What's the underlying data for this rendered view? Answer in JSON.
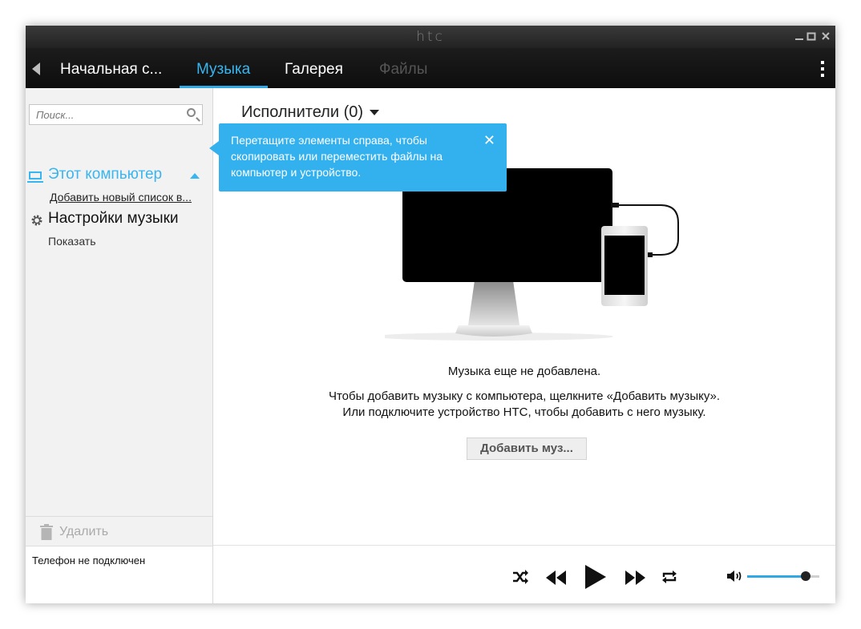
{
  "window": {
    "brand": "htc"
  },
  "nav": {
    "tabs": [
      {
        "label": "Начальная с...",
        "state": "normal"
      },
      {
        "label": "Музыка",
        "state": "active"
      },
      {
        "label": "Галерея",
        "state": "normal"
      },
      {
        "label": "Файлы",
        "state": "disabled"
      }
    ],
    "accent_color": "#2ea9e6"
  },
  "sidebar": {
    "search_placeholder": "Поиск...",
    "computer_label": "Этот компьютер",
    "add_playlist": "Добавить новый список в...",
    "settings_label": "Настройки музыки",
    "show_link": "Показать",
    "delete_label": "Удалить",
    "phone_status": "Телефон не подключен"
  },
  "main": {
    "heading": "Исполнители (0)",
    "tooltip_text": "Перетащите элементы справа, чтобы скопировать или переместить файлы на компьютер и устройство.",
    "tooltip_close": "✕",
    "empty_title": "Музыка еще не добавлена.",
    "empty_desc": "Чтобы добавить музыку с компьютера, щелкните «Добавить музыку». Или подключите устройство HTC, чтобы добавить с него музыку.",
    "add_button": "Добавить муз..."
  },
  "player": {
    "volume_level": 0.81
  }
}
